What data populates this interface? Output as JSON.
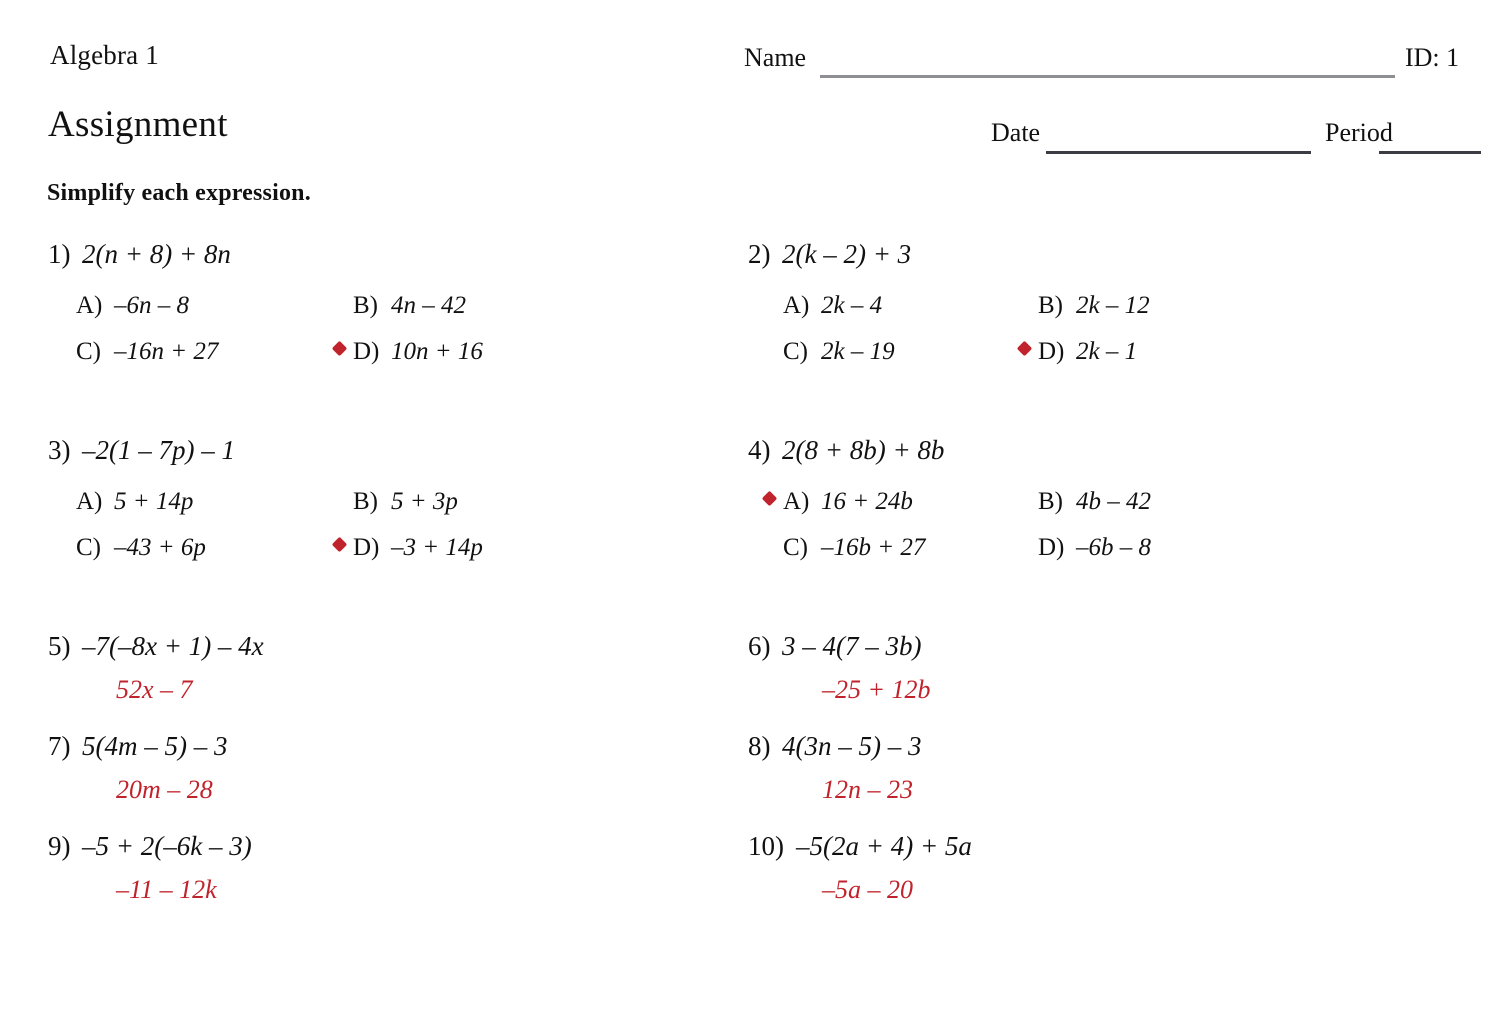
{
  "header": {
    "course": "Algebra 1",
    "title": "Assignment",
    "instruction": "Simplify each expression.",
    "name_label": "Name",
    "id_label": "ID: 1",
    "date_label": "Date",
    "period_label": "Period"
  },
  "style": {
    "answer_color": "#c0232b",
    "marker_color": "#c0232b",
    "text_color": "#111111",
    "name_rule_color": "#8d8f93",
    "date_rule_color": "#3b3d42"
  },
  "problems": [
    {
      "number": "1)",
      "stem": "2(n + 8) + 8n",
      "type": "multiple-choice",
      "correct": "D",
      "choices": [
        {
          "letter": "A)",
          "text": "–6n – 8"
        },
        {
          "letter": "B)",
          "text": "4n – 42"
        },
        {
          "letter": "C)",
          "text": "–16n + 27"
        },
        {
          "letter": "D)",
          "text": "10n + 16"
        }
      ]
    },
    {
      "number": "2)",
      "stem": "2(k – 2) + 3",
      "type": "multiple-choice",
      "correct": "D",
      "choices": [
        {
          "letter": "A)",
          "text": "2k – 4"
        },
        {
          "letter": "B)",
          "text": "2k – 12"
        },
        {
          "letter": "C)",
          "text": "2k – 19"
        },
        {
          "letter": "D)",
          "text": "2k – 1"
        }
      ]
    },
    {
      "number": "3)",
      "stem": "–2(1 – 7p) – 1",
      "type": "multiple-choice",
      "correct": "D",
      "choices": [
        {
          "letter": "A)",
          "text": "5 + 14p"
        },
        {
          "letter": "B)",
          "text": "5 + 3p"
        },
        {
          "letter": "C)",
          "text": "–43 + 6p"
        },
        {
          "letter": "D)",
          "text": "–3 + 14p"
        }
      ]
    },
    {
      "number": "4)",
      "stem": "2(8 + 8b) + 8b",
      "type": "multiple-choice",
      "correct": "A",
      "choices": [
        {
          "letter": "A)",
          "text": "16 + 24b"
        },
        {
          "letter": "B)",
          "text": "4b – 42"
        },
        {
          "letter": "C)",
          "text": "–16b + 27"
        },
        {
          "letter": "D)",
          "text": "–6b – 8"
        }
      ]
    },
    {
      "number": "5)",
      "stem": "–7(–8x + 1) – 4x",
      "type": "free-response",
      "answer": "52x – 7"
    },
    {
      "number": "6)",
      "stem": "3 – 4(7 – 3b)",
      "type": "free-response",
      "answer": "–25 + 12b"
    },
    {
      "number": "7)",
      "stem": "5(4m – 5) – 3",
      "type": "free-response",
      "answer": "20m – 28"
    },
    {
      "number": "8)",
      "stem": "4(3n – 5) – 3",
      "type": "free-response",
      "answer": "12n – 23"
    },
    {
      "number": "9)",
      "stem": "–5 + 2(–6k – 3)",
      "type": "free-response",
      "answer": "–11 – 12k"
    },
    {
      "number": "10)",
      "stem": "–5(2a + 4) + 5a",
      "type": "free-response",
      "answer": "–5a – 20"
    }
  ]
}
